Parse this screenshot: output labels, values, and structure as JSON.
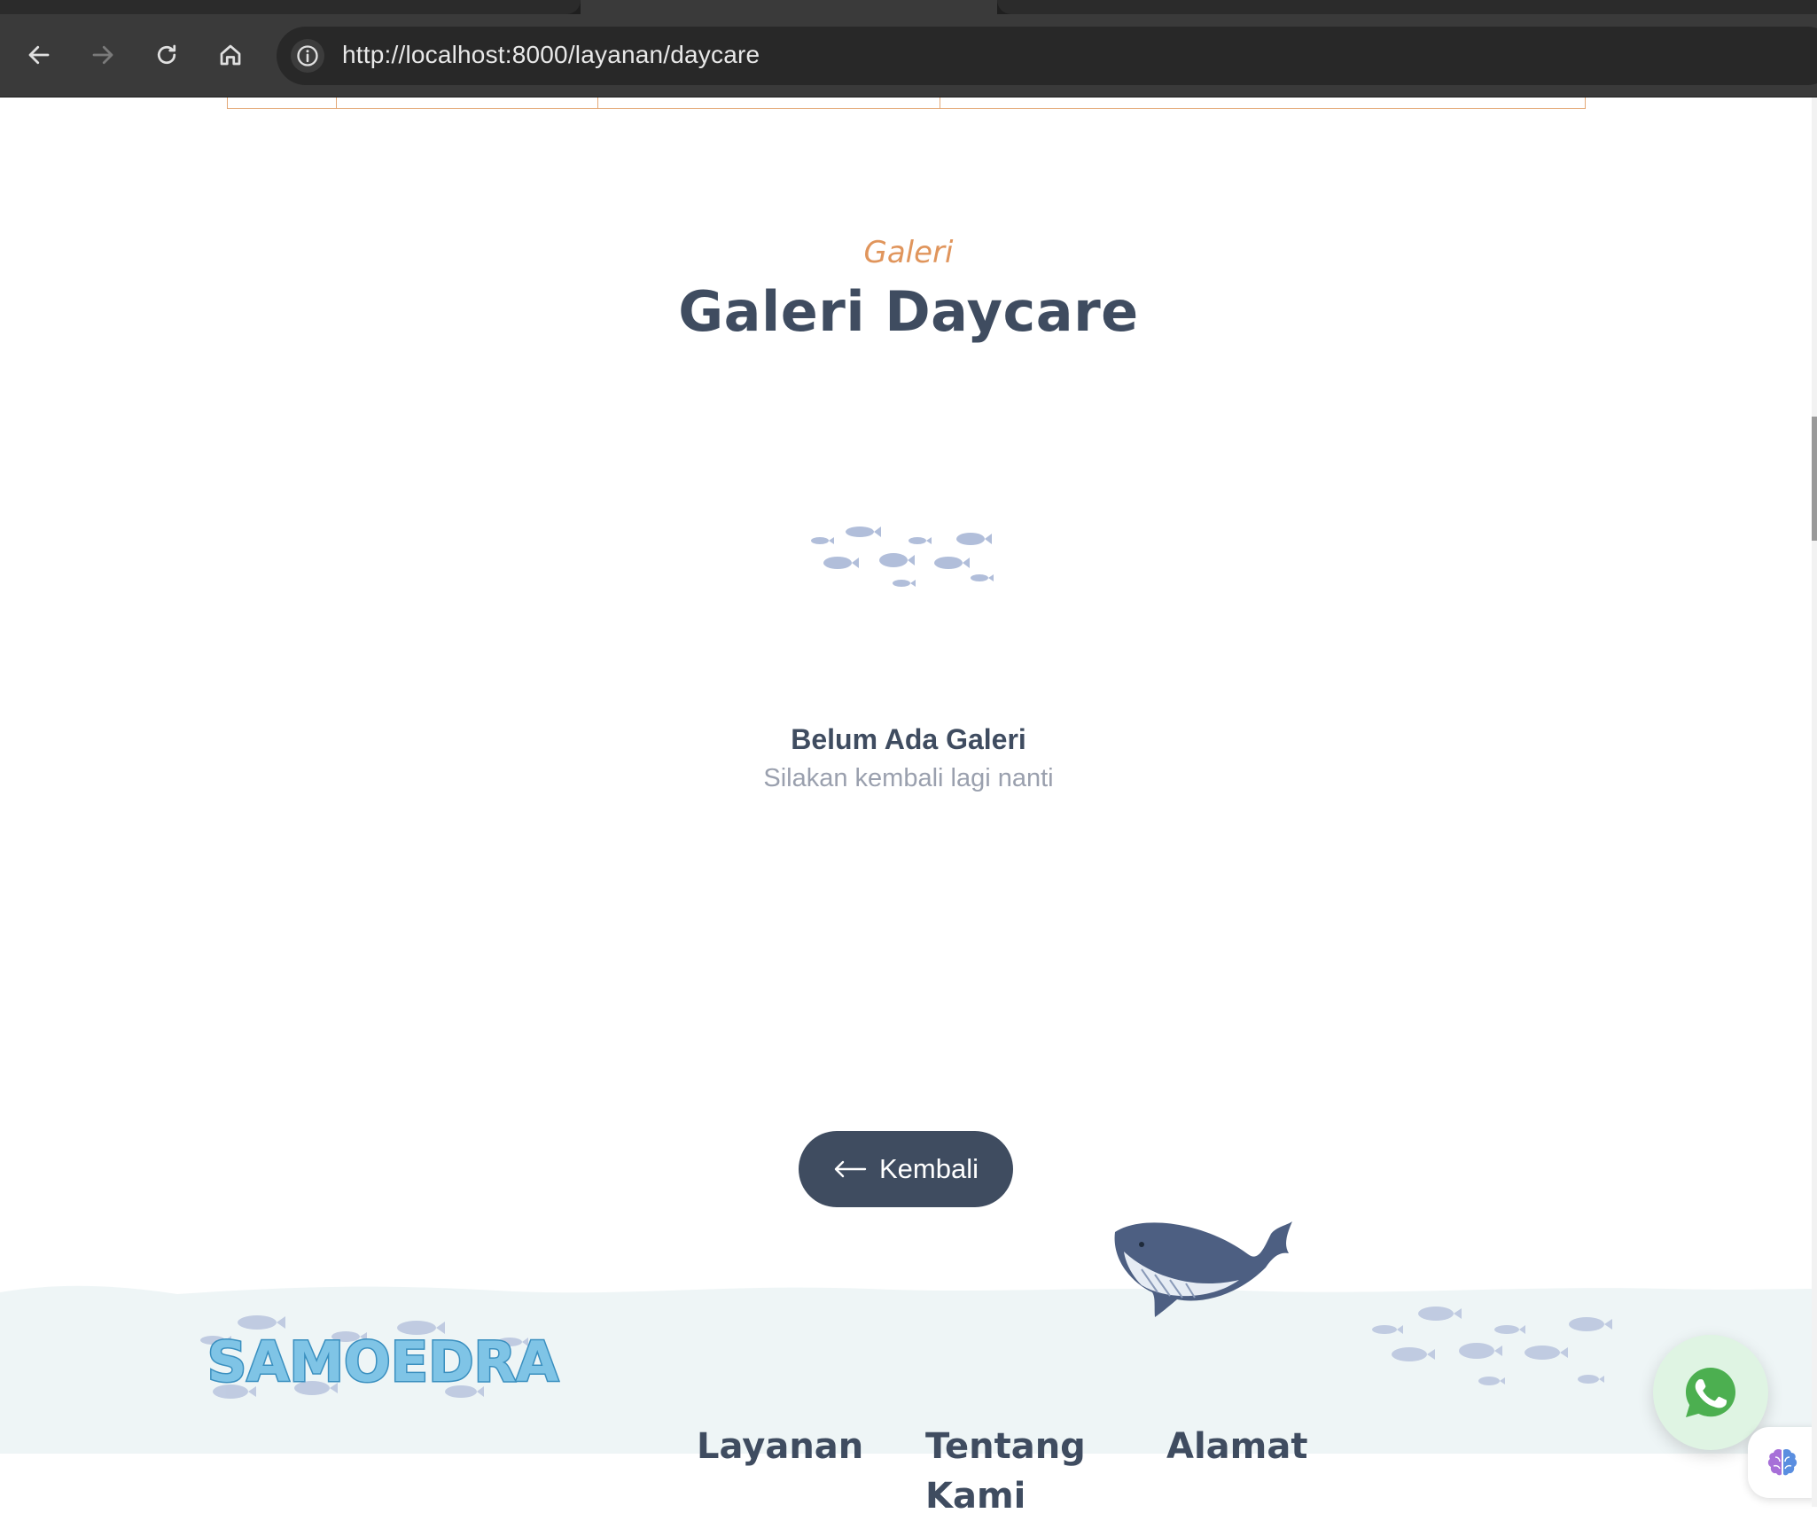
{
  "browser": {
    "url": "http://localhost:8000/layanan/daycare"
  },
  "section": {
    "eyebrow": "Galeri",
    "title": "Galeri Daycare"
  },
  "empty_state": {
    "title": "Belum Ada Galeri",
    "subtitle": "Silakan kembali lagi nanti"
  },
  "back_button": {
    "label": "Kembali"
  },
  "footer": {
    "brand": "SAMOEDRA",
    "headings": {
      "layanan": "Layanan",
      "tentang_kami": "Tentang Kami",
      "alamat": "Alamat"
    }
  },
  "colors": {
    "primary": "#3f4c60",
    "accent": "#e0955c",
    "muted": "#9aa0ae",
    "whatsapp": "#4caf50",
    "footer_bg": "#eef5f6"
  }
}
